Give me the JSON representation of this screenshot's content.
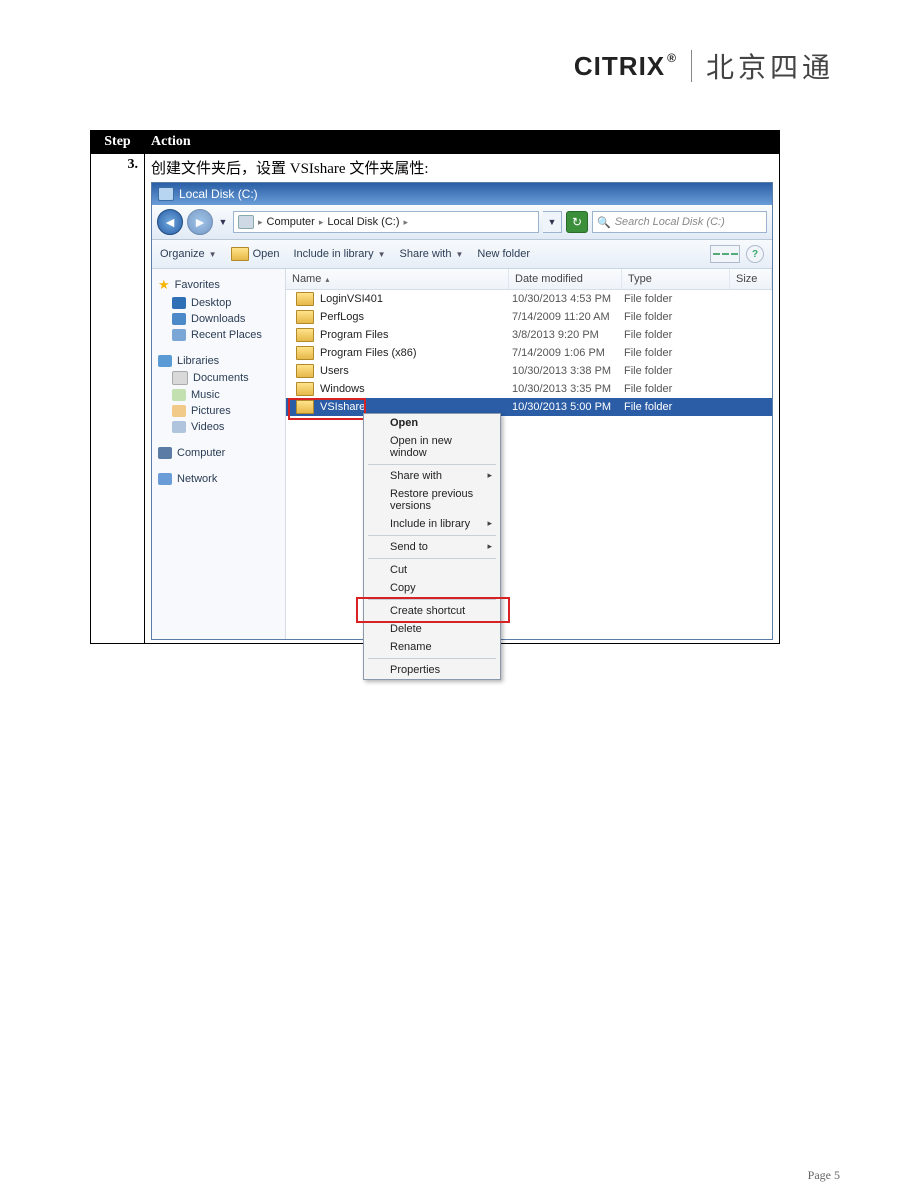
{
  "doc": {
    "brand": "CITRIX",
    "brand_reg": "®",
    "cn_company": "北京四通",
    "header_step": "Step",
    "header_action": "Action",
    "step_num": "3.",
    "action_text": "创建文件夹后，设置 VSIshare 文件夹属性:",
    "page_label": "Page 5"
  },
  "explorer": {
    "title": "Local Disk (C:)",
    "breadcrumb": {
      "seg1": "Computer",
      "seg2": "Local Disk (C:)"
    },
    "search_placeholder": "Search Local Disk (C:)",
    "toolbar": {
      "organize": "Organize",
      "open": "Open",
      "include": "Include in library",
      "share": "Share with",
      "newfolder": "New folder"
    },
    "columns": {
      "name": "Name",
      "date": "Date modified",
      "type": "Type",
      "size": "Size"
    },
    "sidebar": {
      "favorites": "Favorites",
      "desktop": "Desktop",
      "downloads": "Downloads",
      "recent": "Recent Places",
      "libraries": "Libraries",
      "documents": "Documents",
      "music": "Music",
      "pictures": "Pictures",
      "videos": "Videos",
      "computer": "Computer",
      "network": "Network"
    },
    "rows": [
      {
        "name": "LoginVSI401",
        "date": "10/30/2013 4:53 PM",
        "type": "File folder"
      },
      {
        "name": "PerfLogs",
        "date": "7/14/2009 11:20 AM",
        "type": "File folder"
      },
      {
        "name": "Program Files",
        "date": "3/8/2013 9:20 PM",
        "type": "File folder"
      },
      {
        "name": "Program Files (x86)",
        "date": "7/14/2009 1:06 PM",
        "type": "File folder"
      },
      {
        "name": "Users",
        "date": "10/30/2013 3:38 PM",
        "type": "File folder"
      },
      {
        "name": "Windows",
        "date": "10/30/2013 3:35 PM",
        "type": "File folder"
      },
      {
        "name": "VSIshare",
        "date": "10/30/2013 5:00 PM",
        "type": "File folder"
      }
    ],
    "context_menu": {
      "open": "Open",
      "open_new": "Open in new window",
      "share_with": "Share with",
      "restore": "Restore previous versions",
      "include": "Include in library",
      "send_to": "Send to",
      "cut": "Cut",
      "copy": "Copy",
      "shortcut": "Create shortcut",
      "delete": "Delete",
      "rename": "Rename",
      "properties": "Properties"
    }
  }
}
